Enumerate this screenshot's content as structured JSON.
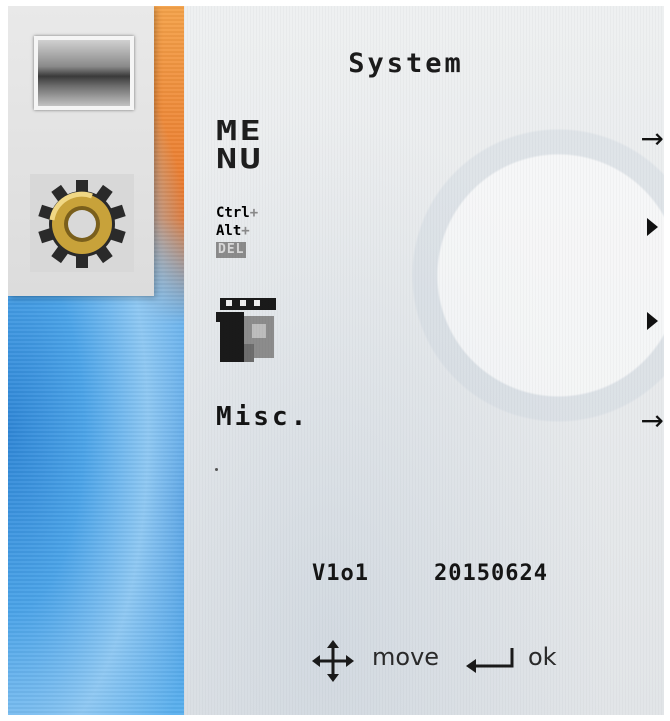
{
  "menu": {
    "title": "System",
    "items": [
      {
        "id": "menu",
        "logo_lines": [
          "ME",
          "NU"
        ],
        "indicator": "→"
      },
      {
        "id": "ctrl-alt-del",
        "logo_lines": [
          "Ctrl",
          "Alt",
          "DEL"
        ],
        "plus": "+",
        "indicator": "▶"
      },
      {
        "id": "ip",
        "indicator": "▶"
      },
      {
        "id": "misc",
        "label": "Misc.",
        "indicator": "→"
      }
    ]
  },
  "footer": {
    "version": "V1o1",
    "build": "20150624",
    "move_label": "move",
    "ok_label": "ok"
  },
  "icons": {
    "sidebar_top": "landscape-photo-icon",
    "sidebar_bottom": "gear-icon",
    "move": "four-way-arrow-icon",
    "ok": "enter-key-icon"
  },
  "colors": {
    "text": "#151515",
    "panel": "#e6e8ea",
    "gear_gold": "#c8a23a",
    "gear_dark": "#2a2a2a"
  }
}
